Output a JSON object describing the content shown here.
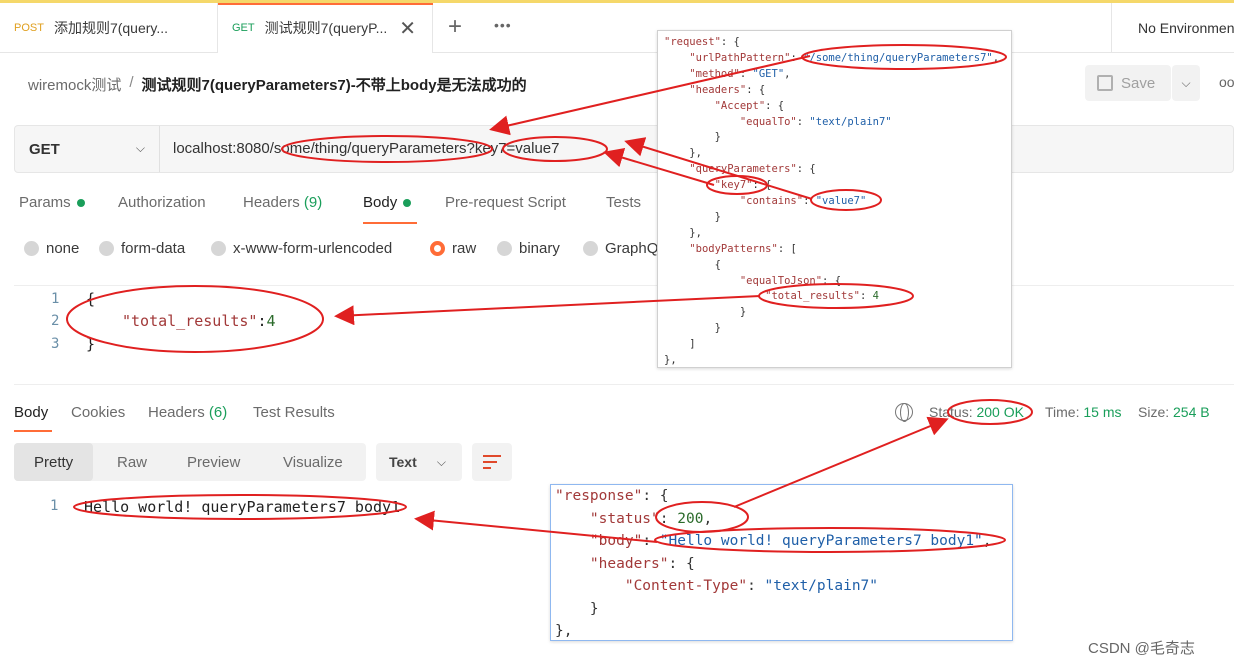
{
  "tabs": [
    {
      "method": "POST",
      "title": "添加规则7(query..."
    },
    {
      "method": "GET",
      "title": "测试规则7(queryP..."
    }
  ],
  "environment": "No Environment",
  "breadcrumb": {
    "collection": "wiremock测试",
    "separator": "/",
    "request": "测试规则7(queryParameters7)-不带上body是无法成功的"
  },
  "save_label": "Save",
  "method": "GET",
  "url": "localhost:8080/some/thing/queryParameters?key7=value7",
  "request_tabs": {
    "params": "Params",
    "authorization": "Authorization",
    "headers": "Headers",
    "headers_count": "(9)",
    "body": "Body",
    "prerequest": "Pre-request Script",
    "tests": "Tests"
  },
  "body_types": {
    "none": "none",
    "form_data": "form-data",
    "urlencoded": "x-www-form-urlencoded",
    "raw": "raw",
    "binary": "binary",
    "graphql": "GraphQ"
  },
  "request_body": {
    "ln1": "1",
    "ln2": "2",
    "ln3": "3",
    "line1": "{",
    "key": "\"total_results\"",
    "colon": ":",
    "value": "4",
    "line3": "}"
  },
  "response_tabs": {
    "body": "Body",
    "cookies": "Cookies",
    "headers": "Headers",
    "headers_count": "(6)",
    "test_results": "Test Results"
  },
  "response_meta": {
    "status_label": "Status:",
    "status_value": "200 OK",
    "time_label": "Time:",
    "time_value": "15 ms",
    "size_label": "Size:",
    "size_value": "254 B"
  },
  "view_modes": {
    "pretty": "Pretty",
    "raw": "Raw",
    "preview": "Preview",
    "visualize": "Visualize"
  },
  "format_select": "Text",
  "response_body": {
    "ln": "1",
    "text": "Hello world! queryParameters7 body1"
  },
  "request_annotation": [
    "\"request\": {",
    "    \"urlPathPattern\": \"/some/thing/queryParameters7\",",
    "    \"method\": \"GET\",",
    "    \"headers\": {",
    "        \"Accept\": {",
    "            \"equalTo\": \"text/plain7\"",
    "        }",
    "    },",
    "    \"queryParameters\": {",
    "        \"key7\": {",
    "            \"contains\": \"value7\"",
    "        }",
    "    },",
    "    \"bodyPatterns\": [",
    "        {",
    "            \"equalToJson\": {",
    "                \"total_results\": 4",
    "            }",
    "        }",
    "    ]",
    "},"
  ],
  "response_annotation": [
    "\"response\": {",
    "    \"status\": 200,",
    "    \"body\": \"Hello world! queryParameters7 body1\",",
    "    \"headers\": {",
    "        \"Content-Type\": \"text/plain7\"",
    "    }",
    "},"
  ],
  "watermark": "CSDN @毛奇志",
  "colors": {
    "accent": "#ff6c37",
    "success": "#1a9e5a",
    "annotation": "#e02020"
  }
}
